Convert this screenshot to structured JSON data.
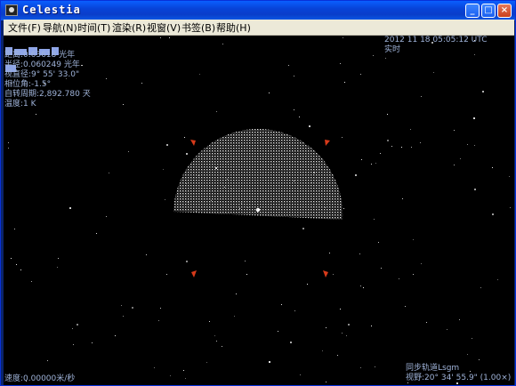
{
  "window": {
    "title": "Celestia",
    "controls": {
      "minimize": "_",
      "maximize": "□",
      "close": "×"
    }
  },
  "menu": {
    "items": [
      "文件(F)",
      "导航(N)",
      "时间(T)",
      "渲染(R)",
      "视窗(V)",
      "书签(B)",
      "帮助(H)"
    ]
  },
  "hud": {
    "object_info": [
      "距离:0.63618 光年",
      "半径:0.060249 光年",
      "视直径:9° 55' 33.0\"",
      "相位角:-1.5°",
      "自转周期:2,892.780 天",
      "温度:1 K"
    ],
    "time": "2012 11 18 05:05:12 UTC",
    "time_mode": "实时",
    "speed": "速度:0.00000米/秒",
    "follow_mode": "同步轨道Lsgm",
    "fov": "视野:20° 34' 55.9\" (1.00×)"
  },
  "colors": {
    "titlebar": "#0a5fff",
    "menubar": "#ece9d8",
    "space": "#000000",
    "hud_text": "#9fb3d9",
    "selection_marker": "#d83a1a"
  },
  "icons": {
    "app": "celestia-app-icon",
    "selection": "selection-bracket-icon"
  }
}
